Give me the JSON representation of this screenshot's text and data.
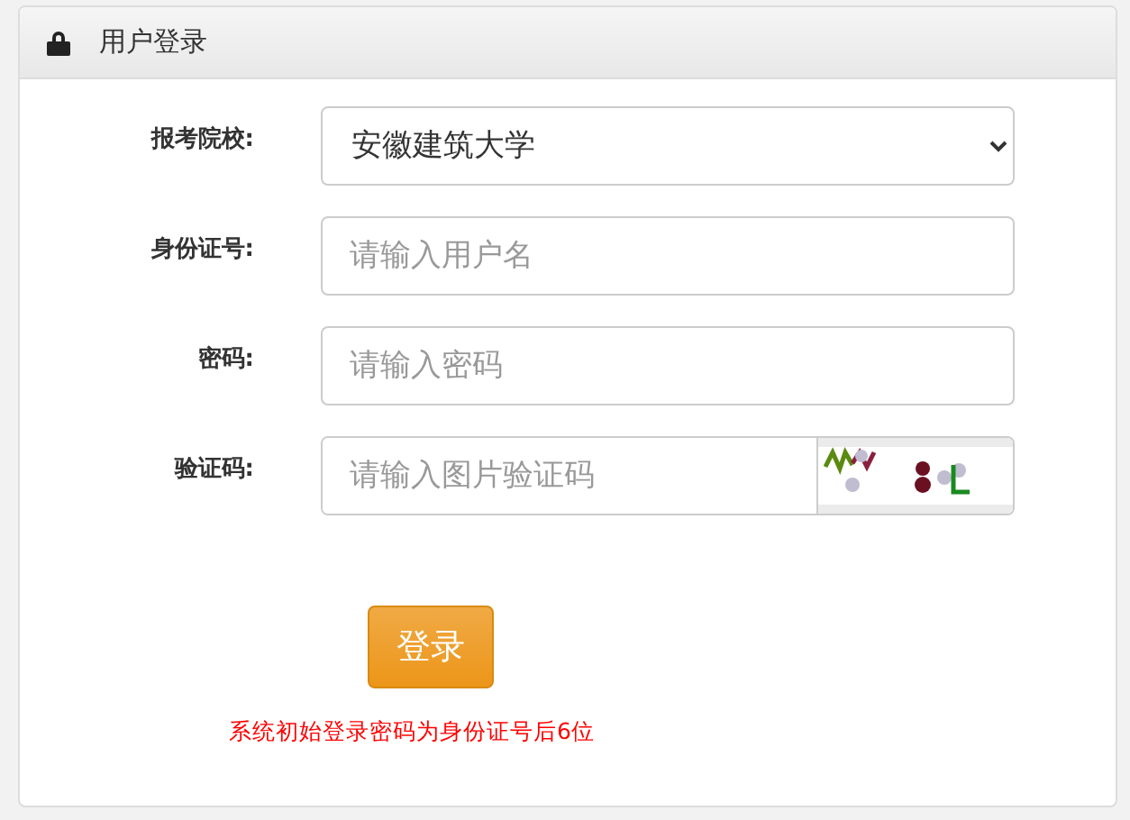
{
  "panel": {
    "title": "用户登录"
  },
  "fields": [
    {
      "kind": "select",
      "label": "报考院校:",
      "value": "安徽建筑大学"
    },
    {
      "kind": "text",
      "label": "身份证号:",
      "placeholder": "请输入用户名"
    },
    {
      "kind": "password",
      "label": "密码:",
      "placeholder": "请输入密码"
    },
    {
      "kind": "captcha",
      "label": "验证码:",
      "placeholder": "请输入图片验证码"
    }
  ],
  "submit": "登录",
  "note": "系统初始登录密码为身份证号后6位"
}
